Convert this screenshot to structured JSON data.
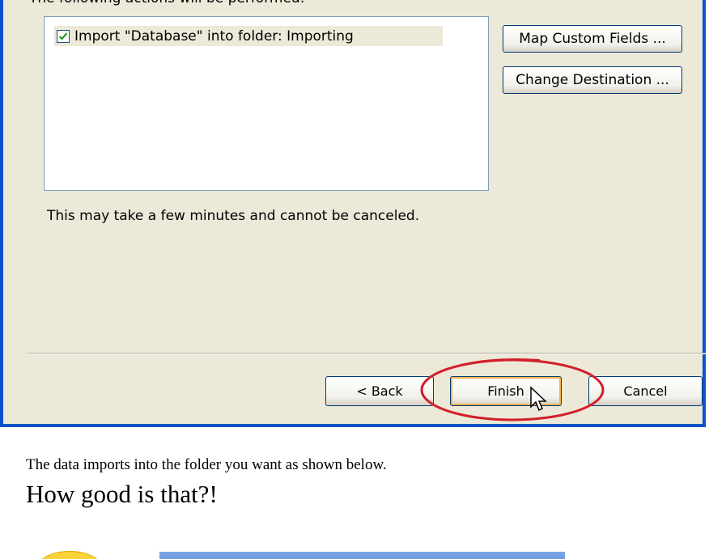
{
  "dialog": {
    "header_partial": "The following actions will be performed:",
    "actions": [
      {
        "label": "Import \"Database\" into folder: Importing",
        "checked": true
      }
    ],
    "side_buttons": {
      "map_custom_fields": "Map Custom Fields ...",
      "change_destination": "Change Destination ..."
    },
    "note": "This may take a few minutes and cannot be canceled.",
    "nav": {
      "back": "< Back",
      "finish": "Finish",
      "cancel": "Cancel"
    },
    "highlight_color": "#d21f2b",
    "border_color": "#0a53c8"
  },
  "article": {
    "caption": "The data imports into the folder you want as shown below.",
    "headline": "How good is that?!"
  }
}
